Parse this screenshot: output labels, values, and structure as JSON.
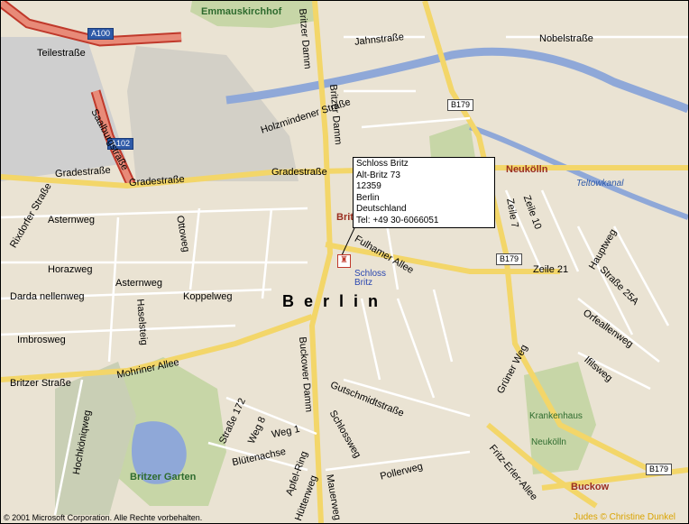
{
  "popup": {
    "name": "Schloss Britz",
    "street": "Alt-Britz 73",
    "zip": "12359",
    "city": "Berlin",
    "country": "Deutschland",
    "phone": "Tel: +49 30-6066051"
  },
  "poi_label": [
    "Schloss",
    "Britz"
  ],
  "poi_icon": "castle-icon",
  "city_label": "Berlin",
  "districts": [
    "Britz",
    "Neukölln",
    "Buckow"
  ],
  "green_areas": [
    "Emmauskirchhof",
    "Britzer Garten",
    "Krankenhaus",
    "Neukölln"
  ],
  "waterways": [
    "Teltowkanal"
  ],
  "road_shields": [
    "A100",
    "A102",
    "B179",
    "B179",
    "B179",
    "B179"
  ],
  "streets": [
    "Teilestraße",
    "Saalburgstraße",
    "Jahnstraße",
    "Nobelstraße",
    "Holzmindener Straße",
    "Britzer Damm",
    "Britzer Damm",
    "Gradestraße",
    "Gradestraße",
    "Gradestraße",
    "Rixdorfer Straße",
    "Asternweg",
    "Ottoweg",
    "Horazweg",
    "Asternweg",
    "Darda nellenweg",
    "Haselsteig",
    "Koppelweg",
    "Imbrosweg",
    "Britzer Straße",
    "Mohriner Allee",
    "Buckower Damm",
    "Gutschmidtstraße",
    "Schlossweg",
    "Straße 172",
    "Weg 8",
    "Weg 1",
    "Blütenachse",
    "Apfel-Ring",
    "Hochköniqweg",
    "Hüttenweg",
    "Mauerweg",
    "Pollerweg",
    "Fulhamer Allee",
    "Grüner Weg",
    "Fritz-Erler-Allee",
    "Zeile 10",
    "Zeile 7",
    "Zeile 21",
    "Hauptweg",
    "Straße 25A",
    "Orfeallenweg",
    "Ifilsweg"
  ],
  "copyright": "© 2001 Microsoft Corporation. Alle Rechte vorbehalten.",
  "credit": "Judes © Christine Dunkel"
}
